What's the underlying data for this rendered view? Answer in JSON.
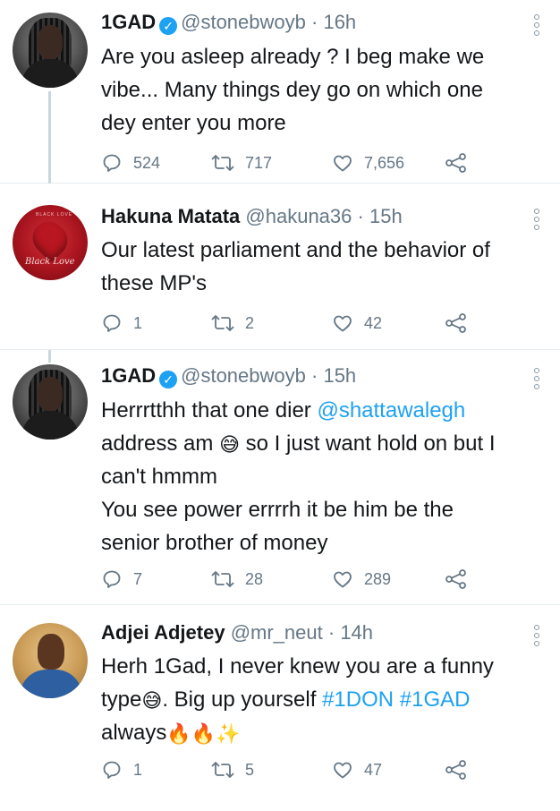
{
  "tweets": [
    {
      "name": "1GAD",
      "verified": true,
      "handle": "@stonebwoyb",
      "separator": "·",
      "time": "16h",
      "text_parts": [
        "Are you asleep already ? I beg make we",
        "vibe... Many things dey go on which one",
        "dey enter you more"
      ],
      "replies": "524",
      "retweets": "717",
      "likes": "7,656"
    },
    {
      "name": "Hakuna Matata",
      "verified": false,
      "handle": "@hakuna36",
      "separator": "·",
      "time": "15h",
      "avatar_text": "Black Love",
      "text_parts": [
        "Our latest parliament and the behavior of",
        "these MP's"
      ],
      "replies": "1",
      "retweets": "2",
      "likes": "42"
    },
    {
      "name": "1GAD",
      "verified": true,
      "handle": "@stonebwoyb",
      "separator": "·",
      "time": "15h",
      "text_parts": {
        "l1_pre": "Herrrtthh that one dier ",
        "l1_mention": "@shattawalegh",
        "l2_pre": "address am ",
        "l2_emoji": "😅",
        "l2_post": " so I just want hold on but I",
        "l3": "can't hmmm",
        "l4": "You see power errrrh it be him be the",
        "l5": "senior brother of money"
      },
      "replies": "7",
      "retweets": "28",
      "likes": "289"
    },
    {
      "name": "Adjei Adjetey",
      "verified": false,
      "handle": "@mr_neut",
      "separator": "·",
      "time": "14h",
      "text_parts": {
        "l1": "Herh 1Gad, I never knew you are a funny",
        "l2_pre": "type",
        "l2_emoji": "😅",
        "l2_mid": ". Big up yourself ",
        "l2_tag1": "#1DON",
        "l2_space": " ",
        "l2_tag2": "#1GAD",
        "l3_pre": "always",
        "l3_emojis": "🔥🔥✨"
      },
      "replies": "1",
      "retweets": "5",
      "likes": "47"
    }
  ],
  "icons": {
    "reply": "reply-icon",
    "retweet": "retweet-icon",
    "like": "like-icon",
    "share": "share-icon",
    "more": "more-options-icon",
    "verified": "verified-badge-icon"
  },
  "colors": {
    "link": "#1da1f2",
    "muted": "#657786",
    "verified": "#1da1f2",
    "divider": "#e6ecf0"
  }
}
